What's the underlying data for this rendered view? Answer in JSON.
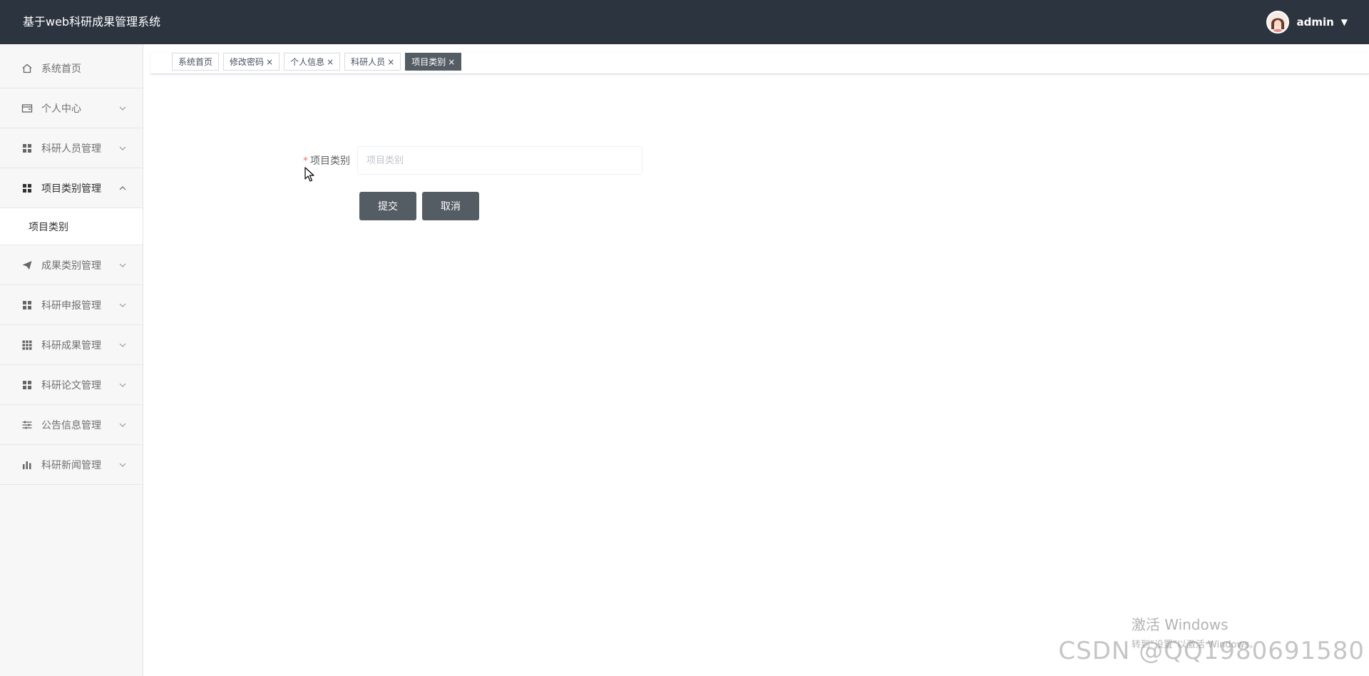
{
  "app": {
    "title": "基于web科研成果管理系统"
  },
  "user": {
    "name": "admin",
    "menu_icon": "caret-down-icon"
  },
  "sidebar": {
    "items": [
      {
        "label": "系统首页",
        "icon": "home-icon"
      },
      {
        "label": "个人中心",
        "icon": "wallet-icon",
        "arrow": "chevron-down"
      },
      {
        "label": "科研人员管理",
        "icon": "grid-icon",
        "arrow": "chevron-down"
      },
      {
        "label": "项目类别管理",
        "icon": "grid-icon",
        "arrow": "chevron-up",
        "open": true
      },
      {
        "label": "成果类别管理",
        "icon": "send-icon",
        "arrow": "chevron-down"
      },
      {
        "label": "科研申报管理",
        "icon": "grid-icon",
        "arrow": "chevron-down"
      },
      {
        "label": "科研成果管理",
        "icon": "grid-nine-icon",
        "arrow": "chevron-down"
      },
      {
        "label": "科研论文管理",
        "icon": "grid-icon",
        "arrow": "chevron-down"
      },
      {
        "label": "公告信息管理",
        "icon": "sliders-icon",
        "arrow": "chevron-down"
      },
      {
        "label": "科研新闻管理",
        "icon": "bar-chart-icon",
        "arrow": "chevron-down"
      }
    ],
    "submenu": {
      "label": "项目类别"
    }
  },
  "tabs": [
    {
      "label": "系统首页",
      "closable": false
    },
    {
      "label": "修改密码",
      "closable": true
    },
    {
      "label": "个人信息",
      "closable": true
    },
    {
      "label": "科研人员",
      "closable": true
    },
    {
      "label": "项目类别",
      "closable": true,
      "active": true
    }
  ],
  "tab_close_glyph": "×",
  "form": {
    "required_mark": "*",
    "field_label": "项目类别",
    "field_value": "",
    "field_placeholder": "项目类别",
    "submit_label": "提交",
    "cancel_label": "取消"
  },
  "watermarks": {
    "windows_line1": "激活 Windows",
    "windows_line2": "转到\"设置\"以激活 Windows。",
    "csdn": "CSDN @QQ1980691580"
  },
  "colors": {
    "topbar": "#2c3440",
    "button": "#545c64",
    "required": "#f56c6c"
  }
}
